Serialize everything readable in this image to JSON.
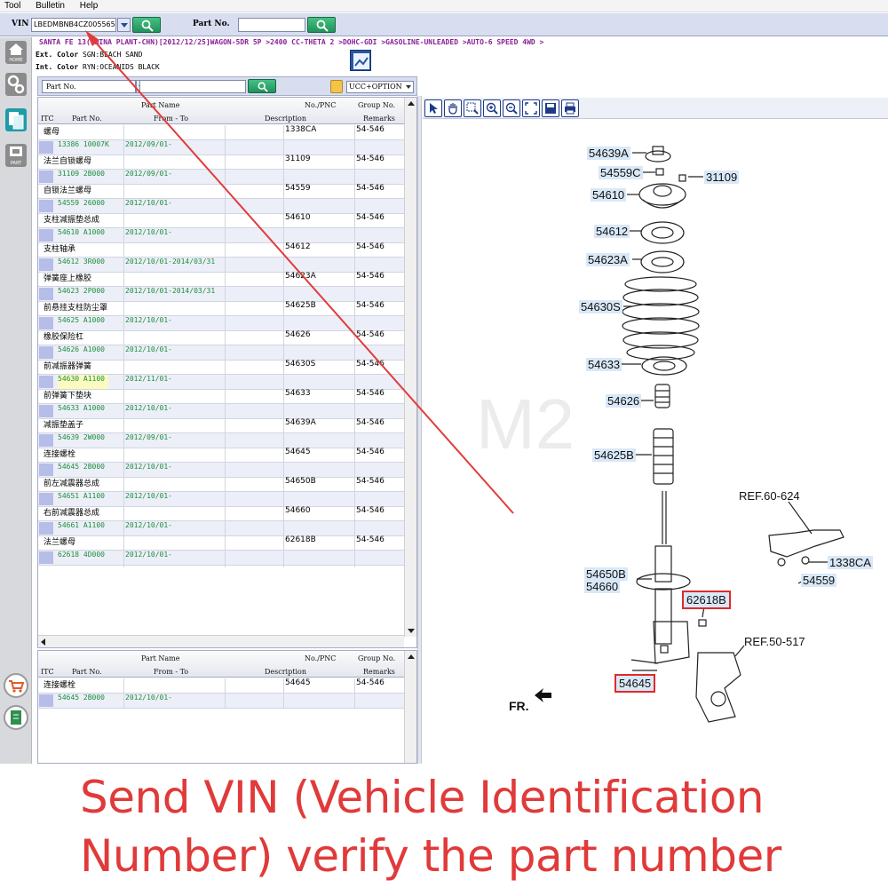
{
  "menu": {
    "items": [
      "Tool",
      "Bulletin",
      "Help"
    ]
  },
  "vin_bar": {
    "vin_label": "VIN",
    "vin_value": "LBEDMBNB4CZ005565",
    "part_label": "Part No.",
    "part_value": ""
  },
  "sidebar": {
    "home_label": "HOME",
    "part_label": "PART"
  },
  "vehicle": {
    "line": "SANTA FE 13(CHINA PLANT-CHN)[2012/12/25]WAGON-5DR 5P >2400 CC-THETA 2 >DOHC-GDI >GASOLINE-UNLEADED >AUTO-6 SPEED 4WD >",
    "ext_label": "Ext. Color",
    "ext_value": "SGN:BEACH SAND",
    "int_label": "Int. Color",
    "int_value": "RYN:OCEANIDS BLACK"
  },
  "filter": {
    "field_label": "Part No.",
    "option_value": "UCC+OPTION"
  },
  "table_headers": {
    "part_name": "Part Name",
    "no_pnc": "No./PNC",
    "group_no": "Group No.",
    "itc": "ITC",
    "part_no": "Part No.",
    "from_to": "From - To",
    "description": "Description",
    "remarks": "Remarks"
  },
  "parts": [
    {
      "name": "螺母",
      "pnc": "1338CA",
      "group": "54-546",
      "part_no": "13386 10007K",
      "date": "2012/09/01-"
    },
    {
      "name": "法兰自锁螺母",
      "pnc": "31109",
      "group": "54-546",
      "part_no": "31109 2B000",
      "date": "2012/09/01-"
    },
    {
      "name": "自锁法兰螺母",
      "pnc": "54559",
      "group": "54-546",
      "part_no": "54559 26000",
      "date": "2012/10/01-"
    },
    {
      "name": "支柱减振垫总成",
      "pnc": "54610",
      "group": "54-546",
      "part_no": "54610 A1000",
      "date": "2012/10/01-"
    },
    {
      "name": "支柱轴承",
      "pnc": "54612",
      "group": "54-546",
      "part_no": "54612 3R000",
      "date": "2012/10/01-2014/03/31"
    },
    {
      "name": "弹簧座上橡胶",
      "pnc": "54623A",
      "group": "54-546",
      "part_no": "54623 2P000",
      "date": "2012/10/01-2014/03/31"
    },
    {
      "name": "前悬挂支柱防尘罩",
      "pnc": "54625B",
      "group": "54-546",
      "part_no": "54625 A1000",
      "date": "2012/10/01-"
    },
    {
      "name": "橡胶保险杠",
      "pnc": "54626",
      "group": "54-546",
      "part_no": "54626 A1000",
      "date": "2012/10/01-"
    },
    {
      "name": "前减振器弹簧",
      "pnc": "54630S",
      "group": "54-546",
      "part_no": "54630 A1100",
      "date": "2012/11/01-"
    },
    {
      "name": "前弹簧下垫块",
      "pnc": "54633",
      "group": "54-546",
      "part_no": "54633 A1000",
      "date": "2012/10/01-"
    },
    {
      "name": "减振垫盖子",
      "pnc": "54639A",
      "group": "54-546",
      "part_no": "54639 2W000",
      "date": "2012/09/01-"
    },
    {
      "name": "连接螺栓",
      "pnc": "54645",
      "group": "54-546",
      "part_no": "54645 2B000",
      "date": "2012/10/01-"
    },
    {
      "name": "前左减震器总成",
      "pnc": "54650B",
      "group": "54-546",
      "part_no": "54651 A1100",
      "date": "2012/10/01-"
    },
    {
      "name": "右前减震器总成",
      "pnc": "54660",
      "group": "54-546",
      "part_no": "54661 A1100",
      "date": "2012/10/01-"
    },
    {
      "name": "法兰螺母",
      "pnc": "62618B",
      "group": "54-546",
      "part_no": "62618 4D000",
      "date": "2012/10/01-"
    }
  ],
  "selected_part": {
    "name": "连接螺栓",
    "pnc": "54645",
    "group": "54-546",
    "part_no": "54645 2B000",
    "date": "2012/10/01-"
  },
  "diagram": {
    "callouts": {
      "c54639A": "54639A",
      "c54559C": "54559C",
      "c31109": "31109",
      "c54610": "54610",
      "c54612": "54612",
      "c54623A": "54623A",
      "c54630S": "54630S",
      "c54633": "54633",
      "c54626": "54626",
      "c54625B": "54625B",
      "cref60": "REF.60-624",
      "c1338CA": "1338CA",
      "c54559": "54559",
      "c54650B": "54650B",
      "c54660": "54660",
      "c62618B": "62618B",
      "cref50": "REF.50-517",
      "c54645": "54645"
    },
    "fr_label": "FR.",
    "watermark": "M2"
  },
  "caption": {
    "line1": "Send VIN (Vehicle Identification",
    "line2": "Number) verify the part number"
  },
  "colors": {
    "caption": "#e03a3a",
    "vehicle_line": "#8a1d99",
    "sub_row_text": "#1d8e3c",
    "highlight_border": "#e02a2a"
  }
}
